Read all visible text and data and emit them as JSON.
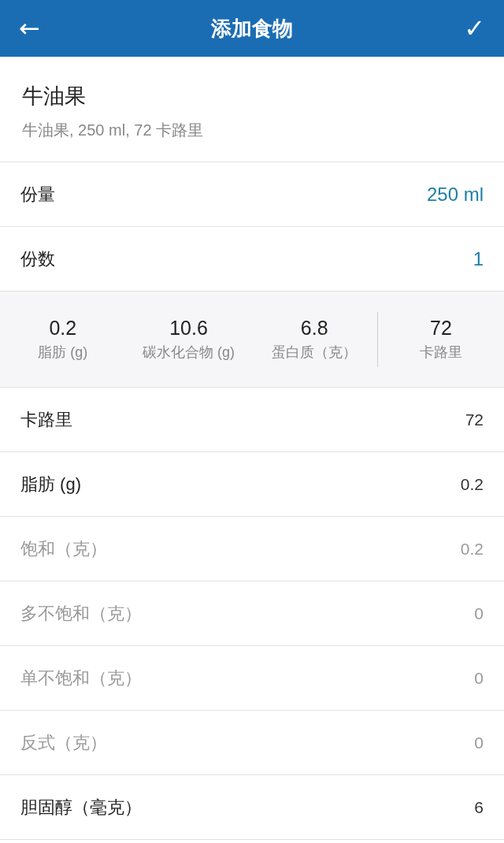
{
  "header": {
    "back": "←",
    "title": "添加食物",
    "confirm": "✓"
  },
  "food": {
    "name": "牛油果",
    "description": "牛油果, 250 ml, 72 卡路里"
  },
  "settings": [
    {
      "label": "份量",
      "value": "250 ml"
    },
    {
      "label": "份数",
      "value": "1"
    }
  ],
  "summary": {
    "macros": [
      {
        "value": "0.2",
        "label": "脂肪 (g)"
      },
      {
        "value": "10.6",
        "label": "碳水化合物 (g)"
      },
      {
        "value": "6.8",
        "label": "蛋白质（克）"
      }
    ],
    "calories": {
      "value": "72",
      "label": "卡路里"
    }
  },
  "nutrients": [
    {
      "kind": "main",
      "label": "卡路里",
      "value": "72"
    },
    {
      "kind": "main",
      "label": "脂肪 (g)",
      "value": "0.2"
    },
    {
      "kind": "sub",
      "label": "饱和（克）",
      "value": "0.2"
    },
    {
      "kind": "sub",
      "label": "多不饱和（克）",
      "value": "0"
    },
    {
      "kind": "sub",
      "label": "单不饱和（克）",
      "value": "0"
    },
    {
      "kind": "sub",
      "label": "反式（克）",
      "value": "0"
    },
    {
      "kind": "main",
      "label": "胆固醇（毫克）",
      "value": "6"
    }
  ]
}
